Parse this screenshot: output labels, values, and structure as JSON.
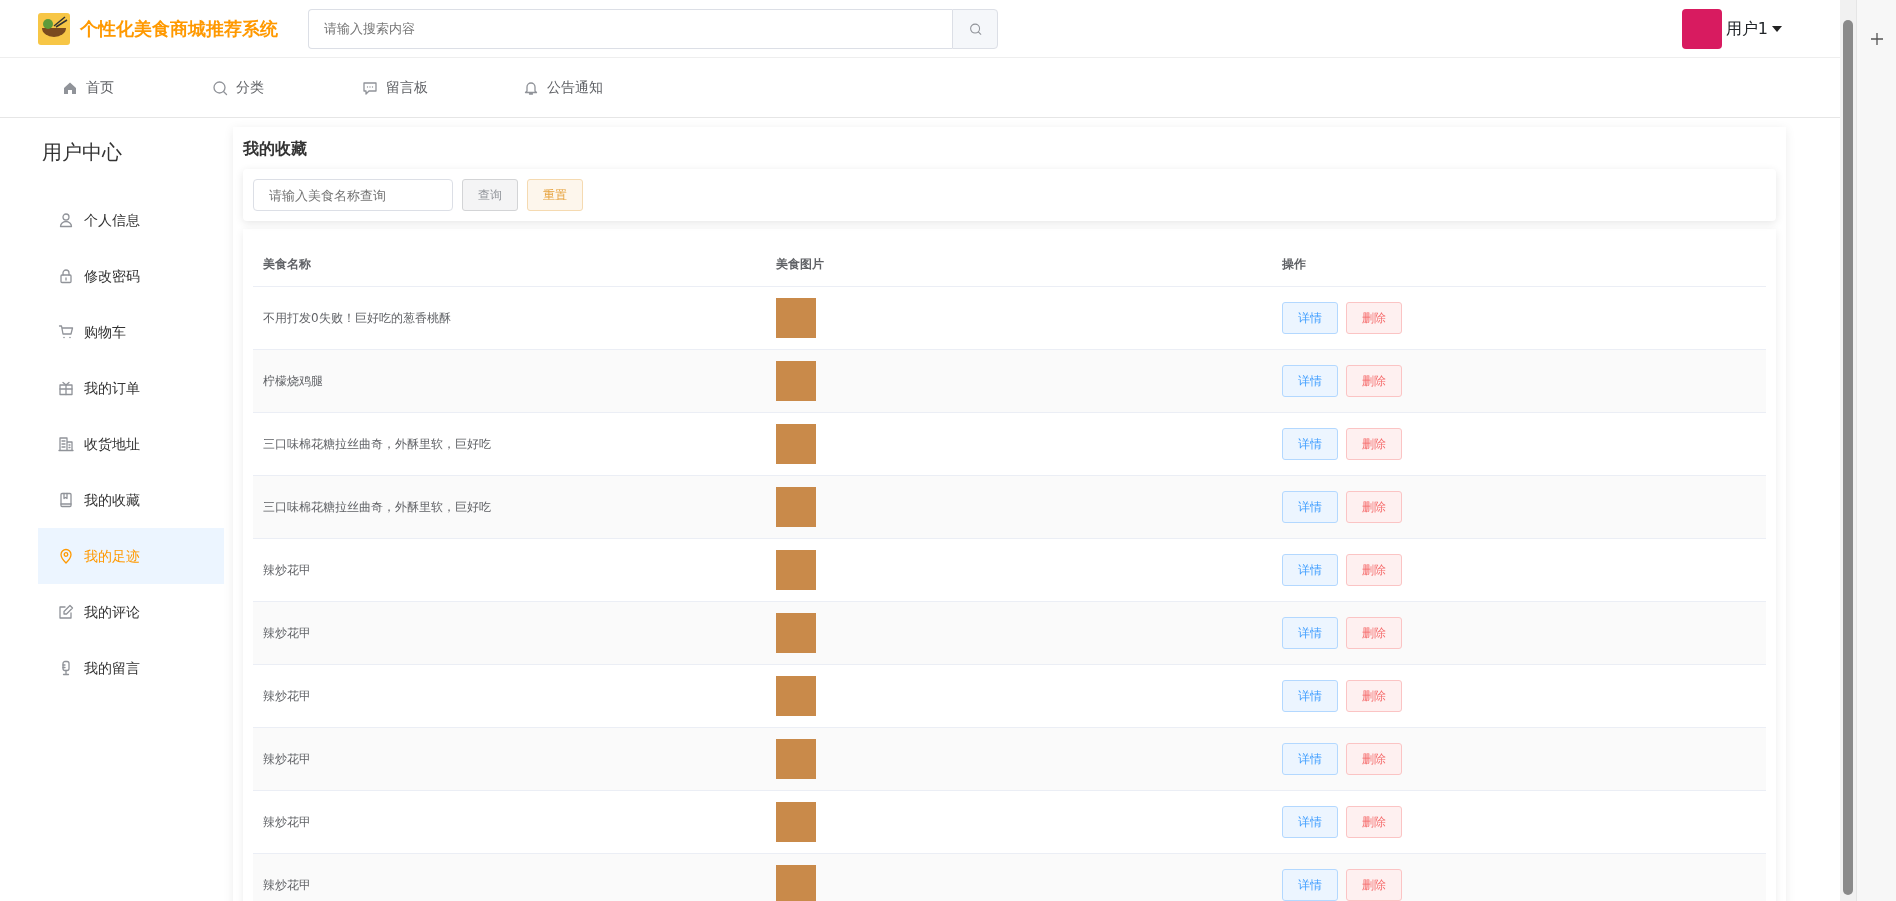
{
  "header": {
    "title": "个性化美食商城推荐系统",
    "search": {
      "placeholder": "请输入搜索内容"
    },
    "user": {
      "name": "用户1"
    }
  },
  "nav": [
    {
      "label": "首页"
    },
    {
      "label": "分类"
    },
    {
      "label": "留言板"
    },
    {
      "label": "公告通知"
    }
  ],
  "sidebar": {
    "title": "用户中心",
    "items": [
      {
        "label": "个人信息",
        "selected": false
      },
      {
        "label": "修改密码",
        "selected": false
      },
      {
        "label": "购物车",
        "selected": false
      },
      {
        "label": "我的订单",
        "selected": false
      },
      {
        "label": "收货地址",
        "selected": false
      },
      {
        "label": "我的收藏",
        "selected": false
      },
      {
        "label": "我的足迹",
        "selected": true
      },
      {
        "label": "我的评论",
        "selected": false
      },
      {
        "label": "我的留言",
        "selected": false
      }
    ]
  },
  "panel": {
    "title": "我的收藏",
    "filter": {
      "placeholder": "请输入美食名称查询",
      "buttons": [
        "查询",
        "重置"
      ]
    },
    "table": {
      "columns": [
        "美食名称",
        "美食图片",
        "操作"
      ],
      "rows": [
        {
          "name": "不用打发0失败！巨好吃的葱香桃酥",
          "actions": [
            "详情",
            "删除"
          ]
        },
        {
          "name": "柠檬烧鸡腿",
          "actions": [
            "详情",
            "删除"
          ]
        },
        {
          "name": "三口味棉花糖拉丝曲奇，外酥里软，巨好吃",
          "actions": [
            "详情",
            "删除"
          ]
        },
        {
          "name": "三口味棉花糖拉丝曲奇，外酥里软，巨好吃",
          "actions": [
            "详情",
            "删除"
          ]
        },
        {
          "name": "辣炒花甲",
          "actions": [
            "详情",
            "删除"
          ]
        },
        {
          "name": "辣炒花甲",
          "actions": [
            "详情",
            "删除"
          ]
        },
        {
          "name": "辣炒花甲",
          "actions": [
            "详情",
            "删除"
          ]
        },
        {
          "name": "辣炒花甲",
          "actions": [
            "详情",
            "删除"
          ]
        },
        {
          "name": "辣炒花甲",
          "actions": [
            "详情",
            "删除"
          ]
        },
        {
          "name": "辣炒花甲",
          "actions": [
            "详情",
            "删除"
          ]
        }
      ]
    }
  }
}
